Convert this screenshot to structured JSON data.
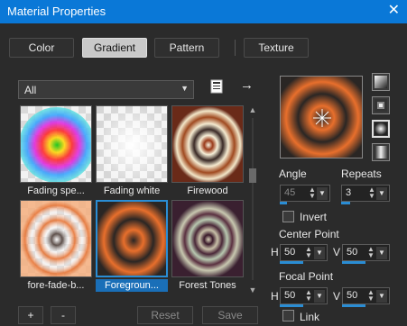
{
  "window": {
    "title": "Material Properties",
    "close_glyph": "✕"
  },
  "tabs": [
    {
      "label": "Color",
      "active": false
    },
    {
      "label": "Gradient",
      "active": true
    },
    {
      "label": "Pattern",
      "active": false
    },
    {
      "label": "Texture",
      "active": false
    }
  ],
  "filter": {
    "selected": "All"
  },
  "icons": {
    "list_icon": "list-icon",
    "arrow": "→"
  },
  "gradients": [
    {
      "label": "Fading spe...",
      "selected": false
    },
    {
      "label": "Fading white",
      "selected": false
    },
    {
      "label": "Firewood",
      "selected": false
    },
    {
      "label": "fore-fade-b...",
      "selected": false
    },
    {
      "label": "Foregroun...",
      "selected": true
    },
    {
      "label": "Forest Tones",
      "selected": false
    }
  ],
  "controls": {
    "angle_label": "Angle",
    "angle_value": "45",
    "repeats_label": "Repeats",
    "repeats_value": "3",
    "invert_label": "Invert",
    "center_label": "Center Point",
    "center_h_label": "H",
    "center_h": "50",
    "center_v_label": "V",
    "center_v": "50",
    "focal_label": "Focal Point",
    "focal_h_label": "H",
    "focal_h": "50",
    "focal_v_label": "V",
    "focal_v": "50",
    "link_label": "Link"
  },
  "buttons": {
    "add": "+",
    "remove": "-",
    "reset": "Reset",
    "save": "Save"
  },
  "colors": {
    "accent": "#0a78d7",
    "selection": "#2a8dd4",
    "orange": "#e86f2c",
    "dark": "#2a2624"
  }
}
